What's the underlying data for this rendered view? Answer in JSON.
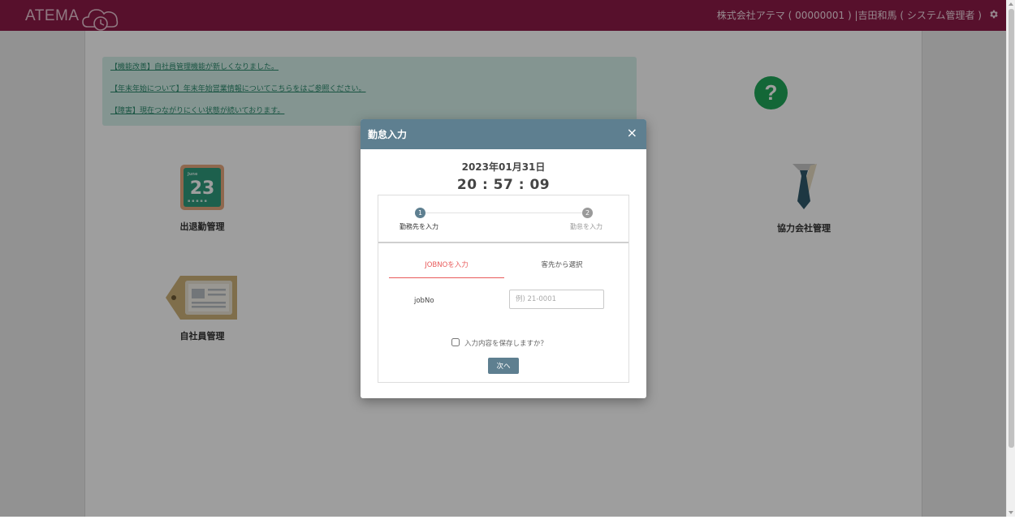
{
  "header": {
    "logo_text": "ATEMA",
    "user_info": "株式会社アテマ ( 00000001 ) |吉田和馬 ( システム管理者 )",
    "color": "#8d1b48"
  },
  "notices": [
    "【機能改善】自社員管理機能が新しくなりました。",
    "【年末年始について】年末年始営業情報についてこちらをはご参照ください。",
    "【障害】現在つながりにくい状態が続いております。"
  ],
  "tiles": {
    "attendance": {
      "label": "出退勤管理",
      "calendar_month": "June",
      "calendar_day": "23"
    },
    "partner": {
      "label": "協力会社管理"
    },
    "employee": {
      "label": "自社員管理"
    }
  },
  "help_icon": "question-icon",
  "modal": {
    "title": "勤怠入力",
    "close": "×",
    "date": "2023年01月31日",
    "time": "20 : 57 : 09",
    "steps": [
      {
        "num": "1",
        "label": "勤務先を入力"
      },
      {
        "num": "2",
        "label": "勤怠を入力"
      }
    ],
    "tabs": [
      "JOBNOを入力",
      "客先から選択"
    ],
    "field_label": "jobNo",
    "field_placeholder": "例) 21-0001",
    "save_label": "入力内容を保存しますか？",
    "next_label": "次へ",
    "accent": "#5e7f90"
  }
}
